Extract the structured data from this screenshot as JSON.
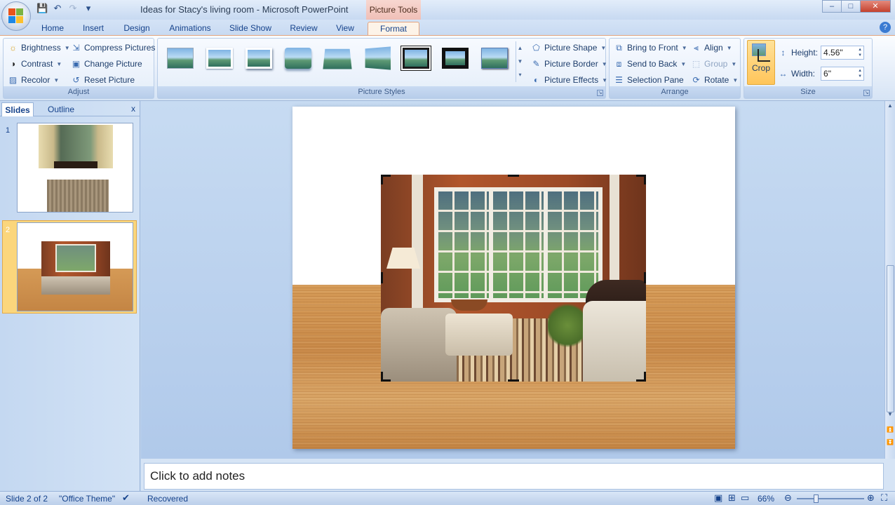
{
  "window": {
    "title": "Ideas for Stacy's living room - Microsoft PowerPoint",
    "context_tab": "Picture Tools",
    "controls": {
      "minimize": "–",
      "maximize": "□",
      "close": "✕"
    }
  },
  "quick_access": {
    "save": "💾",
    "undo": "↶",
    "redo": "↷",
    "customize": "▾"
  },
  "tabs": [
    {
      "label": "Home"
    },
    {
      "label": "Insert"
    },
    {
      "label": "Design"
    },
    {
      "label": "Animations"
    },
    {
      "label": "Slide Show"
    },
    {
      "label": "Review"
    },
    {
      "label": "View"
    },
    {
      "label": "Format",
      "active": true
    }
  ],
  "ribbon": {
    "adjust": {
      "label": "Adjust",
      "brightness": "Brightness",
      "contrast": "Contrast",
      "recolor": "Recolor",
      "compress": "Compress Pictures",
      "change": "Change Picture",
      "reset": "Reset Picture"
    },
    "picture_styles": {
      "label": "Picture Styles",
      "shape": "Picture Shape",
      "border": "Picture Border",
      "effects": "Picture Effects"
    },
    "arrange": {
      "label": "Arrange",
      "bring_front": "Bring to Front",
      "send_back": "Send to Back",
      "selection_pane": "Selection Pane",
      "align": "Align",
      "group": "Group",
      "rotate": "Rotate"
    },
    "size": {
      "label": "Size",
      "crop": "Crop",
      "height_label": "Height:",
      "height_value": "4.56\"",
      "width_label": "Width:",
      "width_value": "6\""
    }
  },
  "left_pane": {
    "tab_slides": "Slides",
    "tab_outline": "Outline",
    "close": "x",
    "slides": [
      {
        "number": "1"
      },
      {
        "number": "2",
        "selected": true
      }
    ]
  },
  "notes": {
    "placeholder": "Click to add notes"
  },
  "status": {
    "slide": "Slide 2 of 2",
    "theme": "\"Office Theme\"",
    "recovered": "Recovered",
    "zoom": "66%",
    "zoom_out": "⊖",
    "zoom_in": "⊕"
  },
  "colors": {
    "ribbon_bg": "#e7effa",
    "active_tab_border": "#e2a47f",
    "crop_active": "#ffc55a",
    "slide_bg": "#ffffff",
    "wood": "#c98a49"
  }
}
